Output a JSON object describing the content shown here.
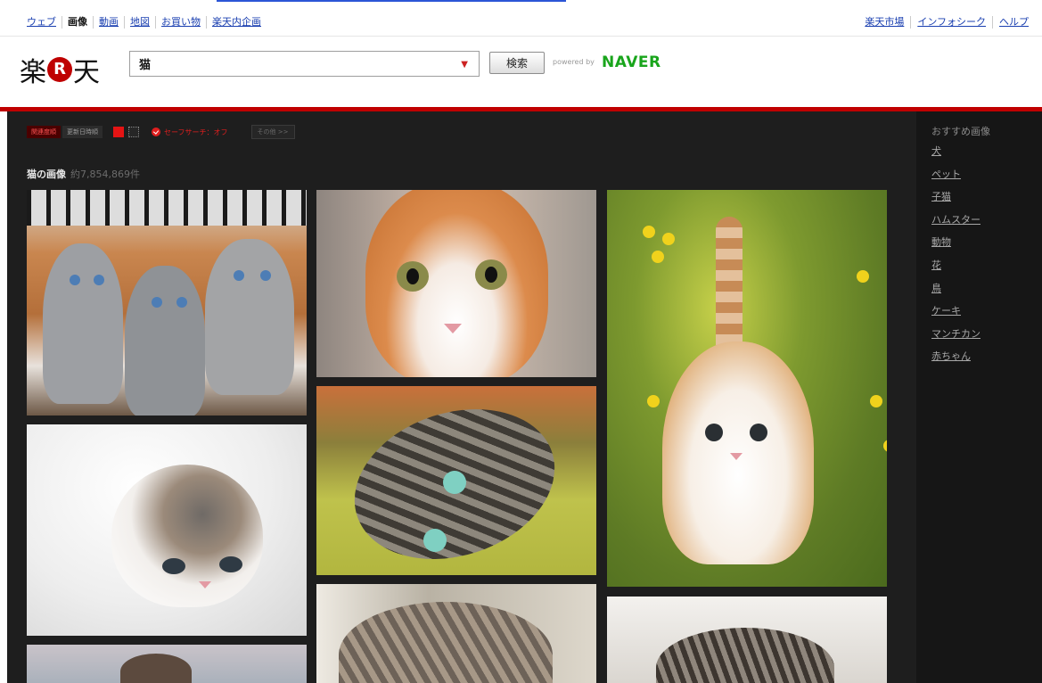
{
  "global_nav": {
    "items": [
      "ウェブ",
      "画像",
      "動画",
      "地図",
      "お買い物",
      "楽天内企画"
    ],
    "active": "画像",
    "right_items": [
      "楽天市場",
      "インフォシーク",
      "ヘルプ"
    ]
  },
  "header": {
    "logo_left": "楽",
    "logo_mark": "R",
    "logo_right": "天",
    "search_value": "猫",
    "search_button": "検索",
    "powered_by": "powered by",
    "naver": "NAVER"
  },
  "toolbar": {
    "sort_relevance": "関連度順",
    "sort_date": "更新日時順",
    "safe_search": "セーフサーチ：オフ",
    "more": "その他 >>"
  },
  "results": {
    "title": "猫の画像",
    "count": "約7,854,869件"
  },
  "sidebar": {
    "title": "おすすめ画像",
    "items": [
      "犬",
      "ペット",
      "子猫",
      "ハムスター",
      "動物",
      "花",
      "鳥",
      "ケーキ",
      "マンチカン",
      "赤ちゃん"
    ]
  },
  "colors": {
    "accent_red": "#c00000",
    "naver_green": "#19a51c",
    "link_blue": "#1a3fb0",
    "main_bg": "#1e1e1e"
  }
}
